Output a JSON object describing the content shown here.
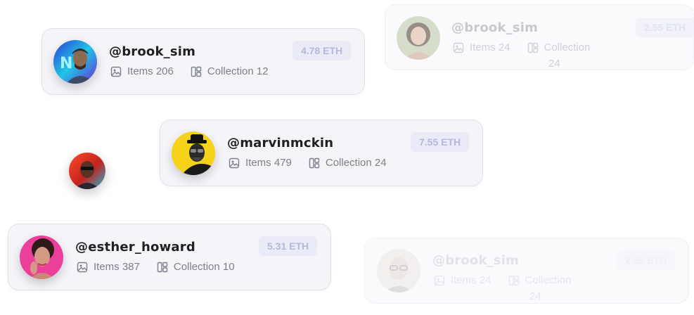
{
  "cards": [
    {
      "handle": "@brook_sim",
      "items_label": "Items 206",
      "collection_label": "Collection 12",
      "price": "4.78 ETH",
      "avatar_icon": "neon-man-avatar"
    },
    {
      "handle": "@marvinmckin",
      "items_label": "Items 479",
      "collection_label": "Collection 24",
      "price": "7.55 ETH",
      "avatar_icon": "hat-man-avatar"
    },
    {
      "handle": "@esther_howard",
      "items_label": "Items 387",
      "collection_label": "Collection 10",
      "price": "5.31 ETH",
      "avatar_icon": "woman-pink-avatar"
    },
    {
      "handle": "@brook_sim",
      "items_label": "Items 24",
      "collection_label": "Collection",
      "collection_value": "24",
      "price": "2.55 ETH",
      "avatar_icon": "woman-smiling-avatar"
    },
    {
      "handle": "@brook_sim",
      "items_label": "Items 24",
      "collection_label": "Collection",
      "collection_value": "24",
      "price": "2.55 ETH",
      "avatar_icon": "glasses-man-avatar"
    }
  ],
  "floating_avatar_icon": "neon-portrait-avatar",
  "colors": {
    "card_bg": "#f3f3f8",
    "price_bg": "#ebebf7",
    "price_text": "#b5b8dc",
    "meta_text": "#7d7f8e"
  }
}
